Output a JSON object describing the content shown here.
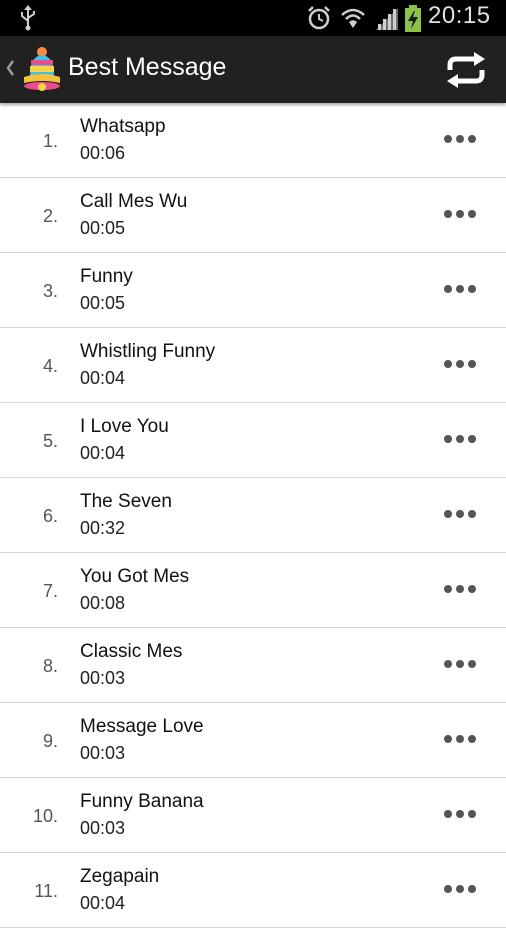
{
  "status_bar": {
    "time": "20:15",
    "icons": [
      "usb-icon",
      "alarm-icon",
      "wifi-icon",
      "signal-icon",
      "battery-charging-icon"
    ]
  },
  "action_bar": {
    "title": "Best Message",
    "app_icon": "bell-icon",
    "action_icon": "refresh-icon"
  },
  "ringtones": [
    {
      "number": "1.",
      "name": "Whatsapp",
      "duration": "00:06"
    },
    {
      "number": "2.",
      "name": "Call Mes Wu",
      "duration": "00:05"
    },
    {
      "number": "3.",
      "name": "Funny",
      "duration": "00:05"
    },
    {
      "number": "4.",
      "name": "Whistling Funny",
      "duration": "00:04"
    },
    {
      "number": "5.",
      "name": "I Love You",
      "duration": "00:04"
    },
    {
      "number": "6.",
      "name": "The Seven",
      "duration": "00:32"
    },
    {
      "number": "7.",
      "name": "You Got Mes",
      "duration": "00:08"
    },
    {
      "number": "8.",
      "name": "Classic Mes",
      "duration": "00:03"
    },
    {
      "number": "9.",
      "name": "Message Love",
      "duration": "00:03"
    },
    {
      "number": "10.",
      "name": "Funny Banana",
      "duration": "00:03"
    },
    {
      "number": "11.",
      "name": "Zegapain",
      "duration": "00:04"
    }
  ],
  "colors": {
    "action_bar_bg": "#212121",
    "status_bar_bg": "#000000",
    "battery_green": "#8bc34a",
    "divider": "#d6d6d6"
  }
}
